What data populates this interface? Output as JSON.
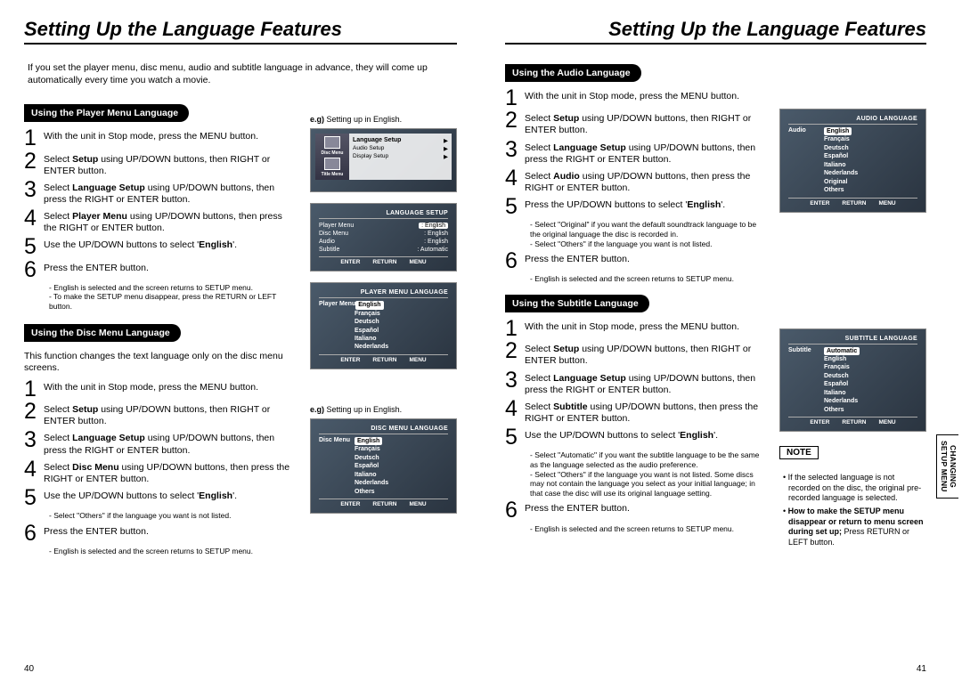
{
  "left": {
    "title": "Setting Up the Language Features",
    "intro": "If you set the player menu, disc menu, audio and subtitle language in advance, they will come up automatically every time you watch a movie.",
    "sectionA": {
      "label": "Using the Player Menu Language",
      "steps": {
        "s1": "With the unit in Stop mode, press the MENU button.",
        "s2a": "Select ",
        "s2b": "Setup",
        "s2c": " using UP/DOWN buttons, then RIGHT or ENTER button.",
        "s3a": "Select ",
        "s3b": "Language Setup",
        "s3c": " using UP/DOWN buttons, then press the RIGHT or ENTER button.",
        "s4a": "Select ",
        "s4b": "Player Menu",
        "s4c": " using UP/DOWN buttons, then press the RIGHT or ENTER button.",
        "s5a": "Use the UP/DOWN buttons to select '",
        "s5b": "English",
        "s5c": "'.",
        "s6": "Press the ENTER button."
      },
      "notes": [
        "- English is selected and the screen returns to SETUP menu.",
        "- To make the SETUP menu disappear, press the RETURN or LEFT button."
      ],
      "eglabel": "e.g)",
      "egtext": " Setting up in English."
    },
    "sectionB": {
      "label": "Using the Disc Menu Language",
      "intro": "This function changes the text language only on the disc menu screens.",
      "steps": {
        "s1": "With the unit in Stop mode, press the MENU button.",
        "s2a": "Select ",
        "s2b": "Setup",
        "s2c": " using UP/DOWN buttons, then RIGHT or ENTER button.",
        "s3a": "Select ",
        "s3b": "Language Setup",
        "s3c": " using UP/DOWN buttons, then press the RIGHT or ENTER button.",
        "s4a": "Select ",
        "s4b": "Disc Menu",
        "s4c": " using UP/DOWN buttons, then press the RIGHT or ENTER button.",
        "s5a": "Use the UP/DOWN buttons to select '",
        "s5b": "English",
        "s5c": "'.",
        "s5n": "- Select \"Others\" if the language you want is not listed.",
        "s6": "Press the ENTER button.",
        "s6n": "- English is selected and the screen returns to SETUP menu."
      },
      "eglabel": "e.g)",
      "egtext": " Setting up in English."
    },
    "pnum": "40"
  },
  "right": {
    "title": "Setting Up the Language Features",
    "sectionC": {
      "label": "Using the Audio Language",
      "steps": {
        "s1": "With the unit in Stop mode, press the MENU button.",
        "s2a": "Select ",
        "s2b": "Setup",
        "s2c": " using UP/DOWN buttons, then RIGHT or ENTER button.",
        "s3a": "Select ",
        "s3b": "Language Setup",
        "s3c": " using UP/DOWN buttons, then press the RIGHT or ENTER button.",
        "s4a": "Select ",
        "s4b": "Audio",
        "s4c": " using UP/DOWN buttons, then press the RIGHT or ENTER button.",
        "s5a": "Press the UP/DOWN buttons to select '",
        "s5b": "English",
        "s5c": "'.",
        "s5n1": "- Select \"Original\" if you want the default soundtrack language to be the original language the disc is recorded in.",
        "s5n2": "- Select \"Others\" if the language you want is not listed.",
        "s6": "Press the ENTER button.",
        "s6n": "- English is selected and the screen returns to SETUP menu."
      }
    },
    "sectionD": {
      "label": "Using the Subtitle Language",
      "steps": {
        "s1": "With the unit in Stop mode, press the MENU button.",
        "s2a": "Select ",
        "s2b": "Setup",
        "s2c": " using UP/DOWN buttons, then RIGHT or ENTER button.",
        "s3a": "Select ",
        "s3b": "Language Setup",
        "s3c": " using UP/DOWN buttons, then press the RIGHT or ENTER button.",
        "s4a": "Select ",
        "s4b": "Subtitle",
        "s4c": " using UP/DOWN buttons, then press the RIGHT or ENTER button.",
        "s5a": "Use the UP/DOWN buttons to select '",
        "s5b": "English",
        "s5c": "'.",
        "s5n1": "- Select \"Automatic\" if you want the subtitle language to be the same as the language selected as the audio preference.",
        "s5n2": "- Select \"Others\" if the language you want is not listed. Some discs may not contain the language you select as your initial language; in that case the disc will use its original language setting.",
        "s6": "Press the ENTER button.",
        "s6n": "- English is selected and the screen returns to SETUP menu."
      }
    },
    "notebox": "NOTE",
    "notes": {
      "n1": "If the selected language is not recorded on the disc, the original pre-recorded language is selected.",
      "n2a": "How to make the SETUP menu disappear or return to menu screen during set up;",
      "n2b": " Press RETURN or LEFT button."
    },
    "sidetab": "CHANGING\nSETUP MENU",
    "pnum": "41",
    "tv": {
      "audio": {
        "hdr": "AUDIO LANGUAGE",
        "side": "Audio",
        "sel": "English",
        "items": [
          "Français",
          "Deutsch",
          "Español",
          "Italiano",
          "Nederlands",
          "Original",
          "Others"
        ],
        "ftr": [
          "ENTER",
          "RETURN",
          "MENU"
        ]
      },
      "subtitle": {
        "hdr": "SUBTITLE LANGUAGE",
        "side": "Subtitle",
        "sel": "Automatic",
        "items": [
          "English",
          "Français",
          "Deutsch",
          "Español",
          "Italiano",
          "Nederlands",
          "Others"
        ],
        "ftr": [
          "ENTER",
          "RETURN",
          "MENU"
        ]
      },
      "lang": {
        "hdr": "LANGUAGE SETUP",
        "rows": [
          [
            "Player Menu",
            ": English"
          ],
          [
            "Disc Menu",
            ": English"
          ],
          [
            "Audio",
            ": English"
          ],
          [
            "Subtitle",
            ": Automatic"
          ]
        ],
        "ftr": [
          "ENTER",
          "RETURN",
          "MENU"
        ]
      },
      "player": {
        "hdr": "PLAYER MENU LANGUAGE",
        "side": "Player Menu",
        "sel": "English",
        "items": [
          "Français",
          "Deutsch",
          "Español",
          "Italiano",
          "Nederlands"
        ],
        "ftr": [
          "ENTER",
          "RETURN",
          "MENU"
        ]
      },
      "discmenu": {
        "hdr": "DISC MENU LANGUAGE",
        "side": "Disc Menu",
        "sel": "English",
        "items": [
          "Français",
          "Deutsch",
          "Español",
          "Italiano",
          "Nederlands",
          "Others"
        ],
        "ftr": [
          "ENTER",
          "RETURN",
          "MENU"
        ]
      },
      "main": {
        "rows": [
          [
            "Language Setup",
            "▶"
          ],
          [
            "Audio Setup",
            "▶"
          ],
          [
            "Display Setup",
            "▶"
          ]
        ],
        "tabs": [
          "Disc Menu",
          "Title Menu"
        ]
      }
    }
  }
}
